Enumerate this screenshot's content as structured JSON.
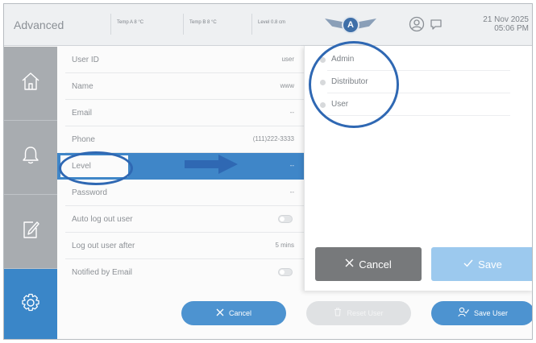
{
  "header": {
    "title": "Advanced",
    "temp_a": "Temp A  8 °C",
    "temp_b": "Temp B  8 °C",
    "level": "Level  0.8 cm",
    "logo_letter": "A",
    "date": "21 Nov 2025",
    "time": "05:06 PM"
  },
  "sidebar": {
    "items": [
      {
        "icon": "home-icon"
      },
      {
        "icon": "bell-icon"
      },
      {
        "icon": "edit-document-icon"
      },
      {
        "icon": "gear-icon",
        "active": true
      }
    ],
    "active_color": "#3a86c8"
  },
  "form": {
    "rows": [
      {
        "label": "User ID",
        "value": "user"
      },
      {
        "label": "Name",
        "value": "www"
      },
      {
        "label": "Email",
        "value": "--"
      },
      {
        "label": "Phone",
        "value": "(111)222-3333"
      },
      {
        "label": "Level",
        "value": "--",
        "selected": true
      },
      {
        "label": "Password",
        "value": "--"
      },
      {
        "label": "Auto log out user",
        "toggle": "off"
      },
      {
        "label": "Log out user after",
        "value": "5 mins"
      },
      {
        "label": "Notified by Email",
        "toggle": "off"
      }
    ]
  },
  "dropdown": {
    "options": [
      "Admin",
      "Distributor",
      "User"
    ],
    "cancel_label": "Cancel",
    "save_label": "Save"
  },
  "actions": {
    "cancel_label": "Cancel",
    "reset_label": "Reset User",
    "save_label": "Save User"
  },
  "colors": {
    "accent": "#3f86c8",
    "callout": "#2f68b3",
    "cancel_dark": "#77797b",
    "save_light": "#9cc9ee"
  }
}
